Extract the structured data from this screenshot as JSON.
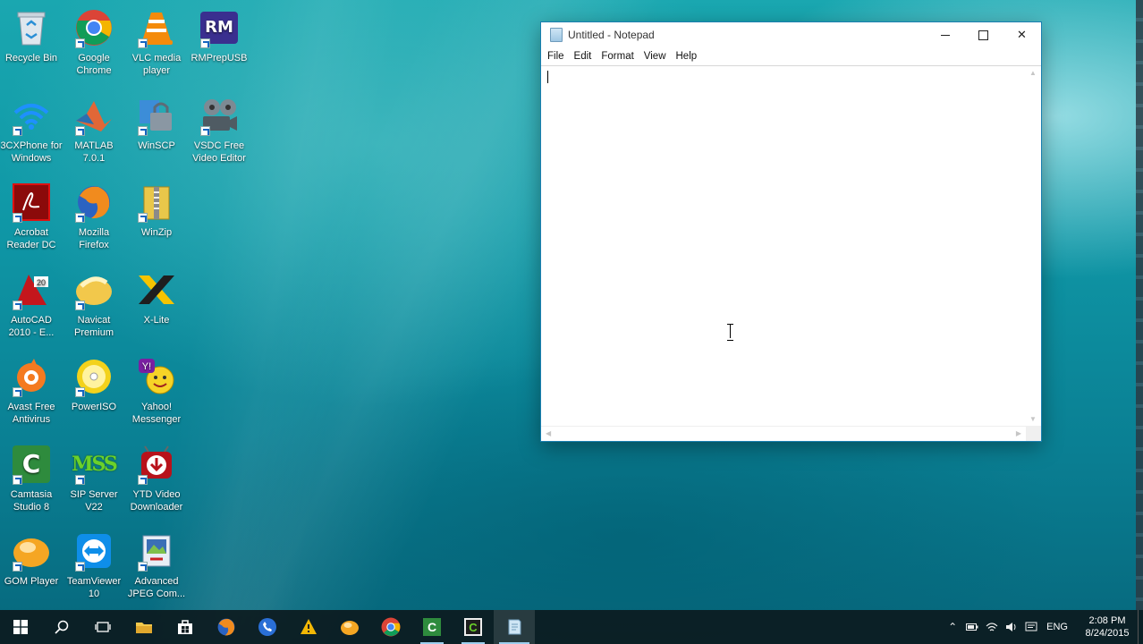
{
  "desktop": {
    "icons": [
      {
        "label": "Recycle Bin",
        "icon": "recycle-bin-icon"
      },
      {
        "label": "Google Chrome",
        "icon": "chrome-icon"
      },
      {
        "label": "VLC media player",
        "icon": "vlc-icon"
      },
      {
        "label": "RMPrepUSB",
        "icon": "rmprepusb-icon"
      },
      {
        "label": "3CXPhone for Windows",
        "icon": "3cxphone-icon"
      },
      {
        "label": "MATLAB 7.0.1",
        "icon": "matlab-icon"
      },
      {
        "label": "WinSCP",
        "icon": "winscp-icon"
      },
      {
        "label": "VSDC Free Video Editor",
        "icon": "vsdc-icon"
      },
      {
        "label": "Acrobat Reader DC",
        "icon": "acrobat-icon"
      },
      {
        "label": "Mozilla Firefox",
        "icon": "firefox-icon"
      },
      {
        "label": "WinZip",
        "icon": "winzip-icon"
      },
      {
        "label": "AutoCAD 2010 - E...",
        "icon": "autocad-icon"
      },
      {
        "label": "Navicat Premium",
        "icon": "navicat-icon"
      },
      {
        "label": "X-Lite",
        "icon": "xlite-icon"
      },
      {
        "label": "Avast Free Antivirus",
        "icon": "avast-icon"
      },
      {
        "label": "PowerISO",
        "icon": "poweriso-icon"
      },
      {
        "label": "Yahoo! Messenger",
        "icon": "yahoo-messenger-icon"
      },
      {
        "label": "Camtasia Studio 8",
        "icon": "camtasia-icon"
      },
      {
        "label": "SIP Server V22",
        "icon": "sip-server-icon"
      },
      {
        "label": "YTD Video Downloader",
        "icon": "ytd-icon"
      },
      {
        "label": "GOM Player",
        "icon": "gom-player-icon"
      },
      {
        "label": "TeamViewer 10",
        "icon": "teamviewer-icon"
      },
      {
        "label": "Advanced JPEG Com...",
        "icon": "jpeg-compressor-icon"
      }
    ]
  },
  "notepad": {
    "title": "Untitled - Notepad",
    "menu": [
      "File",
      "Edit",
      "Format",
      "View",
      "Help"
    ],
    "content": "",
    "close_glyph": "✕"
  },
  "taskbar": {
    "language": "ENG",
    "time": "2:08 PM",
    "date": "8/24/2015",
    "tray_up_glyph": "⌃"
  },
  "colors": {
    "window_border": "#1a7fb0",
    "taskbar_bg": "#0c1a1e"
  }
}
